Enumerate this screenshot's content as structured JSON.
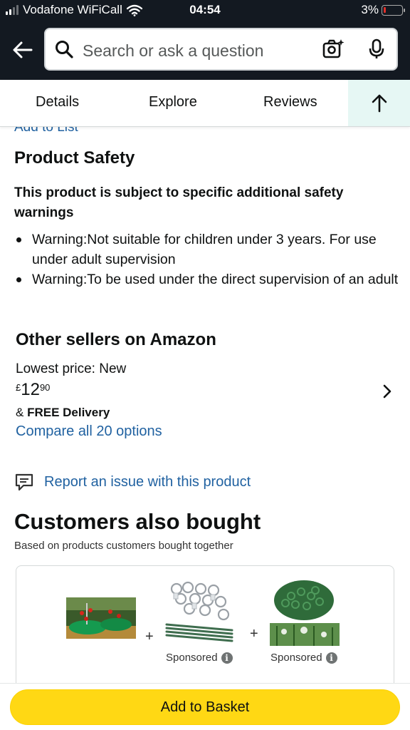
{
  "status_bar": {
    "carrier": "Vodafone WiFiCall",
    "time": "04:54",
    "battery": "3%",
    "battery_level_fraction": 0.03
  },
  "header": {
    "search_placeholder": "Search or ask a question",
    "icons": [
      "back-arrow-icon",
      "search-icon",
      "camera-icon",
      "microphone-icon"
    ]
  },
  "tabs": {
    "items": [
      "Details",
      "Explore",
      "Reviews"
    ],
    "scroll_top_icon": "arrow-up-icon"
  },
  "partial_link": "Add to List",
  "safety": {
    "heading": "Product Safety",
    "subheading": "This product is subject to specific additional safety warnings",
    "warnings": [
      "Warning:Not suitable for children under 3 years. For use under adult supervision",
      "Warning:To be used under the direct supervision of an adult"
    ]
  },
  "other_sellers": {
    "heading": "Other sellers on Amazon",
    "lowest_price_label": "Lowest price: New",
    "price_currency": "£",
    "price_whole": "12",
    "price_fraction": "90",
    "delivery_prefix": "& ",
    "delivery_bold": "FREE Delivery",
    "compare_link": "Compare all 20 options"
  },
  "report_issue": "Report an issue with this product",
  "also_bought": {
    "heading": "Customers also bought",
    "subheading": "Based on products customers bought together",
    "plus": "+",
    "sponsored_label": "Sponsored",
    "info_glyph": "i"
  },
  "add_to_basket": "Add to Basket",
  "colors": {
    "header_bg": "#131921",
    "link": "#2162a1",
    "basket_button": "#ffd814",
    "scroll_top_bg": "#e6f7f4"
  }
}
